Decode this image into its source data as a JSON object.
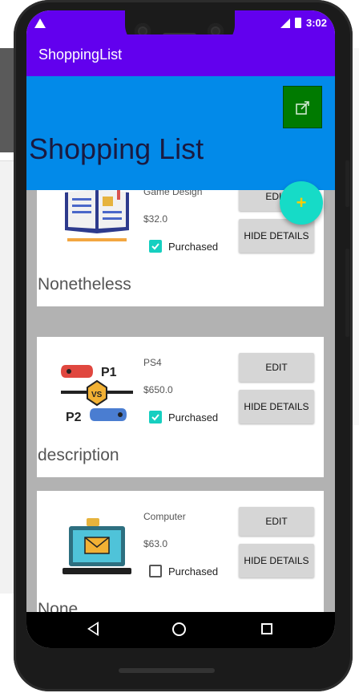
{
  "status_bar": {
    "time": "3:02"
  },
  "app_bar": {
    "title": "ShoppingList"
  },
  "header": {
    "title": "Shopping List"
  },
  "items": [
    {
      "category": "Game Design",
      "price": "$32.0",
      "purchased_label": "Purchased",
      "purchased": true,
      "edit_label": "EDIT",
      "hide_label": "HIDE DETAILS",
      "description": "Nonetheless",
      "icon": "open-book-icon"
    },
    {
      "category": "PS4",
      "price": "$650.0",
      "purchased_label": "Purchased",
      "purchased": true,
      "edit_label": "EDIT",
      "hide_label": "HIDE DETAILS",
      "description": "description",
      "icon": "gamepad-versus-icon"
    },
    {
      "category": "Computer",
      "price": "$63.0",
      "purchased_label": "Purchased",
      "purchased": false,
      "edit_label": "EDIT",
      "hide_label": "HIDE DETAILS",
      "description": "None",
      "icon": "laptop-mail-icon"
    }
  ],
  "colors": {
    "app_bar": "#6200ee",
    "header": "#028ae9",
    "share_button": "#007a00",
    "fab": "#16dbc7",
    "checkbox": "#16cfc0"
  }
}
